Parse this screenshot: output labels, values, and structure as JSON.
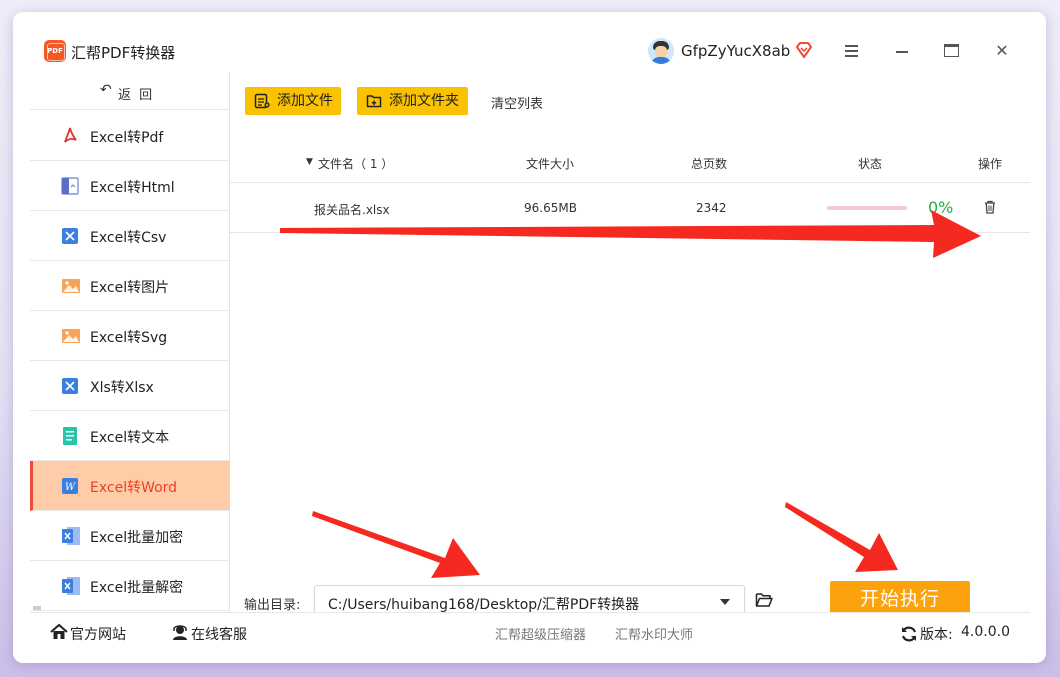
{
  "window": {
    "title": "汇帮PDF转换器",
    "logo_text": "PDF",
    "user": "GfpZyYucX8ab"
  },
  "colors": {
    "accent_orange": "#fca20d",
    "toolbar_yellow": "#fbc103",
    "active_item_bg": "#fecda7",
    "active_item_text": "#ee3e27",
    "progress_green": "#2aab3c",
    "arrow_red": "#f5291f"
  },
  "sidebar": {
    "back_label": "返 回",
    "items": [
      {
        "label": "Excel转Pdf",
        "icon": "pdf-icon"
      },
      {
        "label": "Excel转Html",
        "icon": "html-icon"
      },
      {
        "label": "Excel转Csv",
        "icon": "csv-icon"
      },
      {
        "label": "Excel转图片",
        "icon": "image-icon"
      },
      {
        "label": "Excel转Svg",
        "icon": "svg-image-icon"
      },
      {
        "label": "Xls转Xlsx",
        "icon": "xlsx-icon"
      },
      {
        "label": "Excel转文本",
        "icon": "text-icon"
      },
      {
        "label": "Excel转Word",
        "icon": "word-icon",
        "active": true
      },
      {
        "label": "Excel批量加密",
        "icon": "encrypt-icon"
      },
      {
        "label": "Excel批量解密",
        "icon": "decrypt-icon"
      }
    ]
  },
  "toolbar": {
    "add_file": "添加文件",
    "add_folder": "添加文件夹",
    "clear_list": "清空列表"
  },
  "table": {
    "headers": {
      "filename": "文件名（ 1 ）",
      "size": "文件大小",
      "pages": "总页数",
      "status": "状态",
      "action": "操作"
    },
    "rows": [
      {
        "filename": "报关品名.xlsx",
        "size": "96.65MB",
        "pages": "2342",
        "progress": 0,
        "progress_text": "0%"
      }
    ]
  },
  "output": {
    "label": "输出目录:",
    "path": "C:/Users/huibang168/Desktop/汇帮PDF转换器"
  },
  "start_button": "开始执行",
  "bottom": {
    "website": "官方网站",
    "support": "在线客服",
    "compressor": "汇帮超级压缩器",
    "watermark": "汇帮水印大师",
    "version_label": "版本:",
    "version": "4.0.0.0"
  }
}
